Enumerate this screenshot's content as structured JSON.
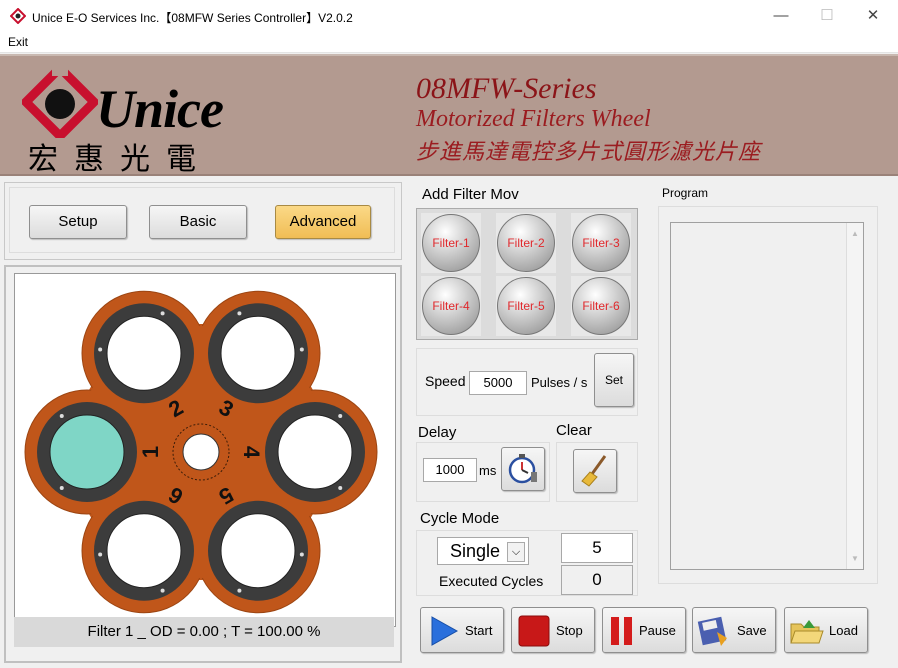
{
  "window": {
    "title": "Unice E-O Services Inc.【08MFW Series Controller】V2.0.2",
    "minimize": "—",
    "maximize": "☐",
    "close": "✕"
  },
  "menu": {
    "exit": "Exit"
  },
  "banner": {
    "logo_en": "Unice",
    "logo_cn": "宏惠光電",
    "series": "08MFW-Series",
    "subtitle": "Motorized Filters Wheel",
    "subtitle_cn": "步進馬達電控多片式圓形濾光片座"
  },
  "tabs": {
    "setup": "Setup",
    "basic": "Basic",
    "advanced": "Advanced"
  },
  "wheel": {
    "numbers": [
      "1",
      "2",
      "3",
      "4",
      "5",
      "6"
    ],
    "status": "Filter 1 _ OD = 0.00 ; T = 100.00 %",
    "colors": {
      "body": "#c0561a",
      "ring": "#3c3c3c",
      "selected": "#7fd6c6"
    }
  },
  "add_filter": {
    "title": "Add Filter Mov",
    "filters": [
      "Filter-1",
      "Filter-2",
      "Filter-3",
      "Filter-4",
      "Filter-5",
      "Filter-6"
    ]
  },
  "speed": {
    "label": "Speed",
    "value": "5000",
    "unit": "Pulses / s",
    "set": "Set"
  },
  "delay": {
    "label": "Delay",
    "value": "1000",
    "unit": "ms"
  },
  "clear": {
    "label": "Clear"
  },
  "cycle": {
    "label": "Cycle Mode",
    "mode": "Single",
    "count": "5",
    "executed_label": "Executed Cycles",
    "executed": "0"
  },
  "program": {
    "title": "Program"
  },
  "actions": {
    "start": "Start",
    "stop": "Stop",
    "pause": "Pause",
    "save": "Save",
    "load": "Load"
  }
}
